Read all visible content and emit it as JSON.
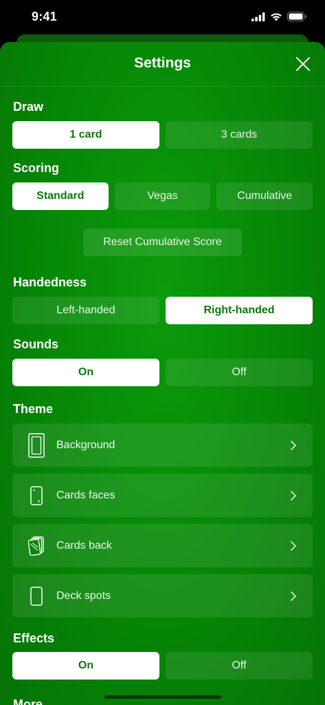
{
  "status_bar": {
    "time": "9:41"
  },
  "header": {
    "title": "Settings"
  },
  "draw": {
    "label": "Draw",
    "options": [
      "1 card",
      "3 cards"
    ],
    "selected": "1 card"
  },
  "scoring": {
    "label": "Scoring",
    "options": [
      "Standard",
      "Vegas",
      "Cumulative"
    ],
    "selected": "Standard",
    "reset_label": "Reset Cumulative Score"
  },
  "handedness": {
    "label": "Handedness",
    "options": [
      "Left-handed",
      "Right-handed"
    ],
    "selected": "Right-handed"
  },
  "sounds": {
    "label": "Sounds",
    "options": [
      "On",
      "Off"
    ],
    "selected": "On"
  },
  "theme": {
    "label": "Theme",
    "items": [
      {
        "label": "Background",
        "icon": "background-icon"
      },
      {
        "label": "Cards faces",
        "icon": "card-faces-icon"
      },
      {
        "label": "Cards back",
        "icon": "card-back-icon"
      },
      {
        "label": "Deck spots",
        "icon": "deck-spots-icon"
      }
    ]
  },
  "effects": {
    "label": "Effects",
    "options": [
      "On",
      "Off"
    ],
    "selected": "On"
  },
  "more": {
    "label": "More"
  },
  "colors": {
    "accent_green": "#0b7a0b",
    "sheet_green": "#078a07",
    "selected_bg": "#ffffff"
  }
}
